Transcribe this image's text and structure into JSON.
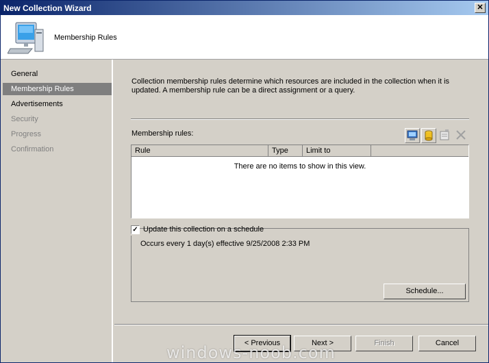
{
  "window": {
    "title": "New Collection Wizard",
    "close_glyph": "✕"
  },
  "header": {
    "title": "Membership Rules",
    "icon": "computer-icon"
  },
  "nav": {
    "items": [
      {
        "label": "General",
        "state": "normal"
      },
      {
        "label": "Membership Rules",
        "state": "active"
      },
      {
        "label": "Advertisements",
        "state": "normal"
      },
      {
        "label": "Security",
        "state": "disabled"
      },
      {
        "label": "Progress",
        "state": "disabled"
      },
      {
        "label": "Confirmation",
        "state": "disabled"
      }
    ]
  },
  "main": {
    "description": "Collection membership rules determine which resources are included in the collection when it is updated. A membership rule can be a direct assignment or a query.",
    "rules_label": "Membership rules:",
    "toolbar": [
      "new-direct-rule-icon",
      "new-query-rule-icon",
      "properties-icon",
      "delete-icon"
    ],
    "columns": [
      "Rule",
      "Type",
      "Limit to"
    ],
    "empty_message": "There are no items to show in this view.",
    "schedule": {
      "checkbox_label": "Update this collection on a schedule",
      "checked": true,
      "text": "Occurs every 1 day(s) effective 9/25/2008 2:33 PM",
      "button_label": "Schedule..."
    }
  },
  "footer": {
    "previous": "< Previous",
    "next": "Next >",
    "finish": "Finish",
    "cancel": "Cancel"
  },
  "watermark": "windows-noob.com",
  "colors": {
    "title_start": "#0a246a",
    "title_end": "#a6caf0",
    "selection": "#7f7f7f",
    "face": "#d4d0c8"
  }
}
